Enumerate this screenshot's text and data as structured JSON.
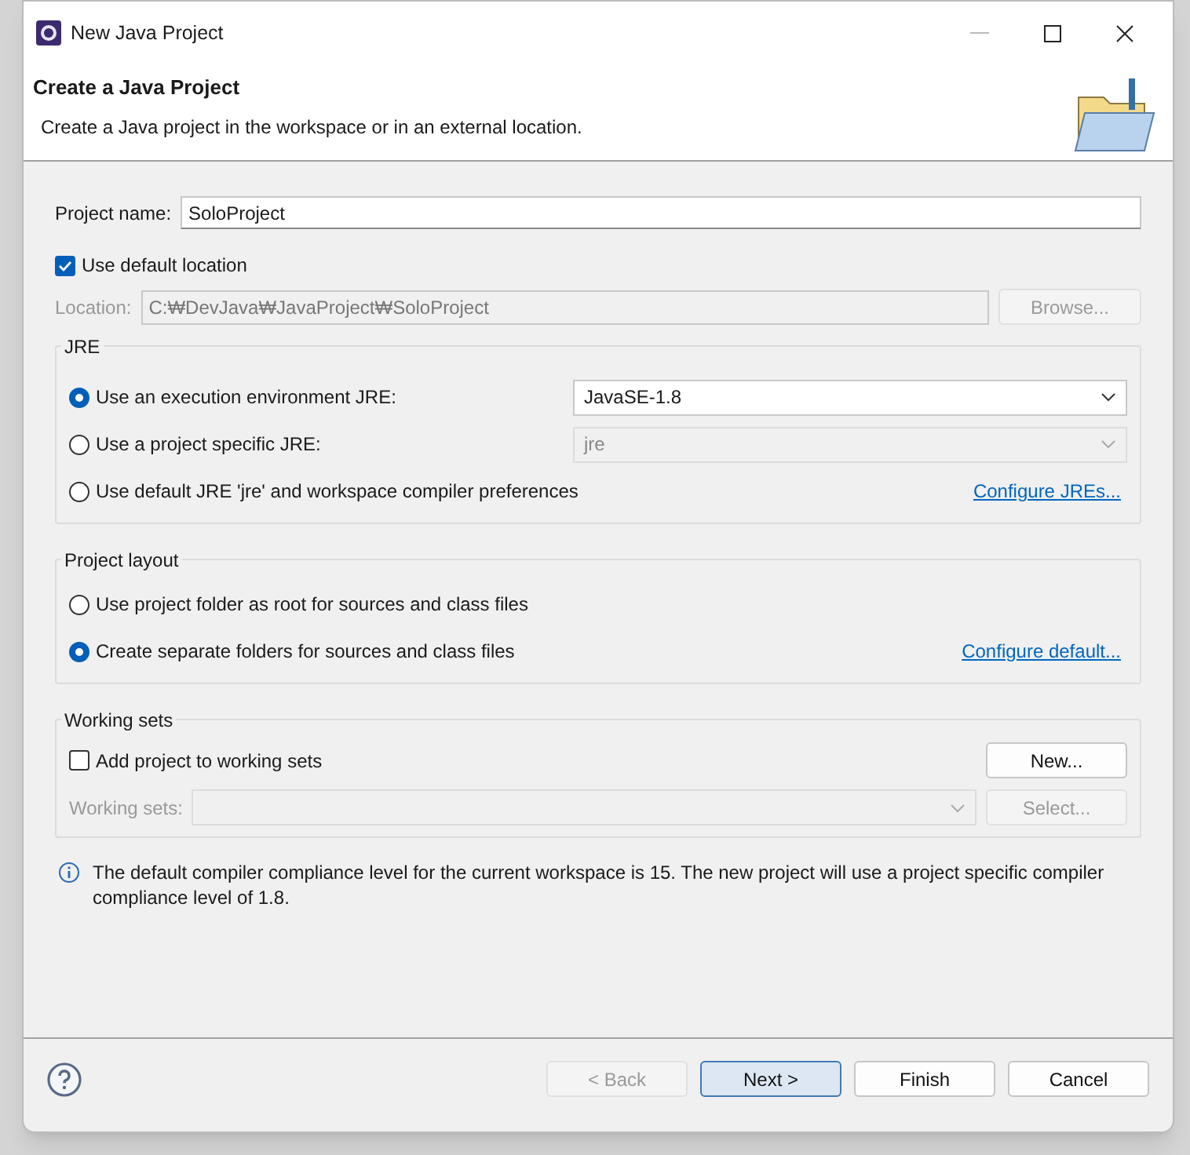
{
  "window": {
    "title": "New Java Project"
  },
  "header": {
    "title": "Create a Java Project",
    "description": "Create a Java project in the workspace or in an external location."
  },
  "project_name": {
    "label": "Project name:",
    "value": "SoloProject"
  },
  "use_default_location": {
    "label": "Use default location",
    "checked": true
  },
  "location": {
    "label": "Location:",
    "value": "C:₩DevJava₩JavaProject₩SoloProject",
    "disabled": true
  },
  "browse_button": {
    "label": "Browse...",
    "disabled": true
  },
  "jre": {
    "title": "JRE",
    "options": [
      {
        "label": "Use an execution environment JRE:",
        "selected": true,
        "dropdown": {
          "value": "JavaSE-1.8",
          "disabled": false
        }
      },
      {
        "label": "Use a project specific JRE:",
        "selected": false,
        "dropdown": {
          "value": "jre",
          "disabled": true
        }
      },
      {
        "label": "Use default JRE 'jre' and workspace compiler preferences",
        "selected": false,
        "link": "Configure JREs..."
      }
    ]
  },
  "project_layout": {
    "title": "Project layout",
    "options": [
      {
        "label": "Use project folder as root for sources and class files",
        "selected": false
      },
      {
        "label": "Create separate folders for sources and class files",
        "selected": true,
        "link": "Configure default..."
      }
    ]
  },
  "working_sets": {
    "title": "Working sets",
    "add_checkbox": {
      "label": "Add project to working sets",
      "checked": false
    },
    "new_button": {
      "label": "New...",
      "disabled": false
    },
    "field": {
      "label": "Working sets:",
      "disabled": true
    },
    "select_button": {
      "label": "Select...",
      "disabled": true
    }
  },
  "info_message": "The default compiler compliance level for the current workspace is 15. The new project will use a project specific compiler compliance level of 1.8.",
  "buttons": [
    {
      "label": "< Back",
      "disabled": true,
      "default": false
    },
    {
      "label": "Next >",
      "disabled": false,
      "default": true
    },
    {
      "label": "Finish",
      "disabled": false,
      "default": false
    },
    {
      "label": "Cancel",
      "disabled": false,
      "default": false
    }
  ]
}
